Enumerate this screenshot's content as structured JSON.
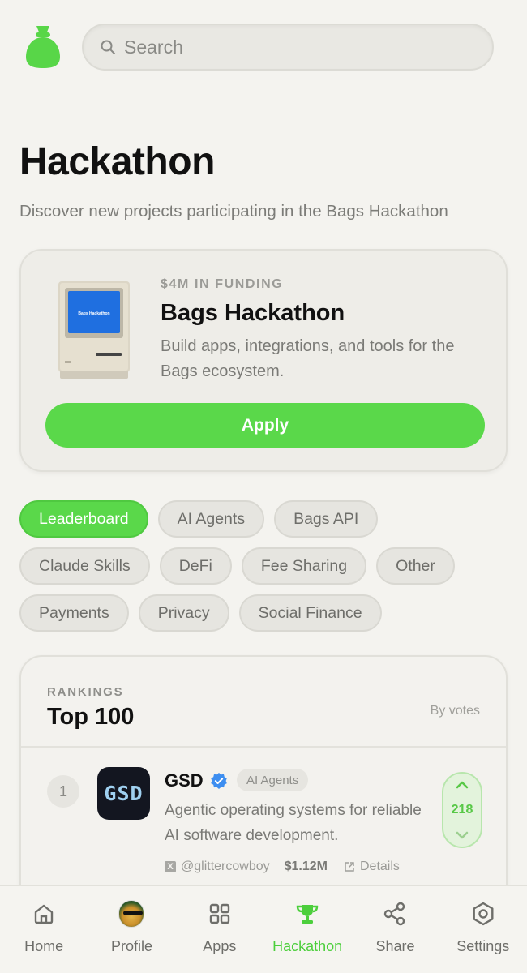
{
  "search": {
    "placeholder": "Search"
  },
  "page": {
    "title": "Hackathon",
    "subtitle": "Discover new projects participating in the Bags Hackathon"
  },
  "hero": {
    "eyebrow": "$4M IN FUNDING",
    "title": "Bags Hackathon",
    "description": "Build apps, integrations, and tools for the Bags ecosystem.",
    "screen_text": "Bags Hackathon",
    "apply_label": "Apply"
  },
  "categories": {
    "row1": [
      "Leaderboard",
      "AI Agents",
      "Bags API"
    ],
    "row2": [
      "Claude Skills",
      "DeFi",
      "Fee Sharing",
      "Other"
    ],
    "row3": [
      "Payments",
      "Privacy",
      "Social Finance"
    ],
    "active": "Leaderboard"
  },
  "rankings": {
    "eyebrow": "RANKINGS",
    "title": "Top 100",
    "sort_label": "By votes",
    "items": [
      {
        "rank": "1",
        "logo_text": "GSD",
        "name": "GSD",
        "category": "AI Agents",
        "description": "Agentic operating systems for reliable AI software development.",
        "handle": "@glittercowboy",
        "market_cap": "$1.12M",
        "details_label": "Details",
        "votes": "218"
      }
    ]
  },
  "tabbar": {
    "items": [
      {
        "label": "Home",
        "icon": "home-icon"
      },
      {
        "label": "Profile",
        "icon": "avatar"
      },
      {
        "label": "Apps",
        "icon": "grid-icon"
      },
      {
        "label": "Hackathon",
        "icon": "trophy-icon"
      },
      {
        "label": "Share",
        "icon": "share-icon"
      },
      {
        "label": "Settings",
        "icon": "settings-icon"
      }
    ],
    "active": "Hackathon"
  },
  "colors": {
    "accent": "#5ad84a",
    "background": "#f4f3ef",
    "verified": "#3d8ef0"
  }
}
